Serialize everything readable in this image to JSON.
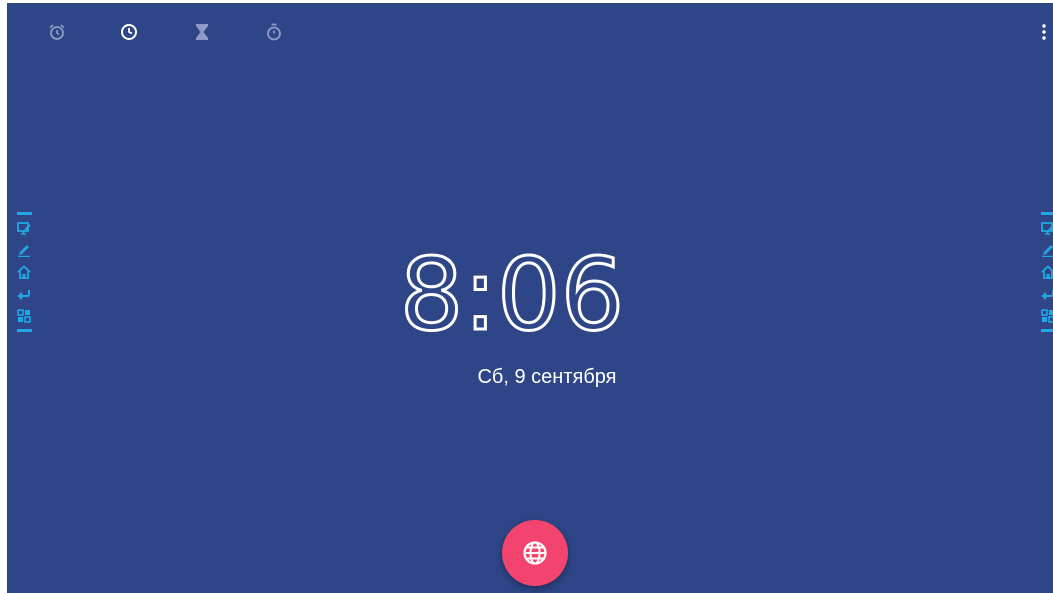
{
  "tabs": [
    {
      "name": "alarm",
      "icon": "alarm-clock-icon",
      "active": false
    },
    {
      "name": "clock",
      "icon": "clock-icon",
      "active": true
    },
    {
      "name": "timer",
      "icon": "hourglass-icon",
      "active": false
    },
    {
      "name": "stopwatch",
      "icon": "stopwatch-icon",
      "active": false
    }
  ],
  "overflow_menu_icon": "more-vert-icon",
  "side_toolbar_tools": [
    "screen-annotate-icon",
    "pen-icon",
    "home-icon",
    "back-icon",
    "apps-icon"
  ],
  "clock": {
    "time": "8:06",
    "date": "Сб, 9 сентября"
  },
  "fab_icon": "globe-icon",
  "colors": {
    "background": "#2e4688",
    "accent": "#f2446e",
    "toolbar": "#1ea9e6",
    "text": "#ffffff"
  }
}
